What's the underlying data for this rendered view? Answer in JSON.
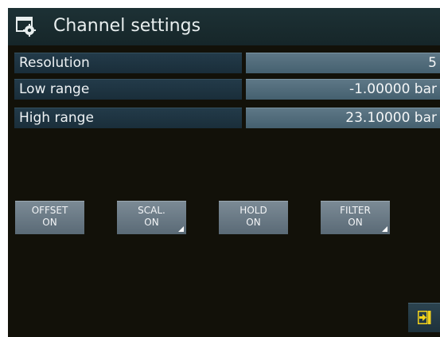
{
  "window": {
    "title": "Channel settings",
    "icon": "window-settings-icon"
  },
  "settings": [
    {
      "label": "Resolution",
      "value": "5"
    },
    {
      "label": "Low range",
      "value": "-1.00000 bar"
    },
    {
      "label": "High range",
      "value": "23.10000 bar"
    }
  ],
  "buttons": {
    "offset": {
      "line1": "OFFSET",
      "line2": "ON"
    },
    "scal": {
      "line1": "SCAL.",
      "line2": "ON"
    },
    "hold": {
      "line1": "HOLD",
      "line2": "ON"
    },
    "filter": {
      "line1": "FILTER",
      "line2": "ON"
    }
  },
  "exit": {
    "icon": "exit-arrow-icon"
  },
  "colors": {
    "background": "#121109",
    "title_bar": "#1d3135",
    "label_cell": "#233b4a",
    "value_cell": "#5f7887",
    "button": "#7c8b96",
    "exit_icon": "#f2d21b"
  }
}
